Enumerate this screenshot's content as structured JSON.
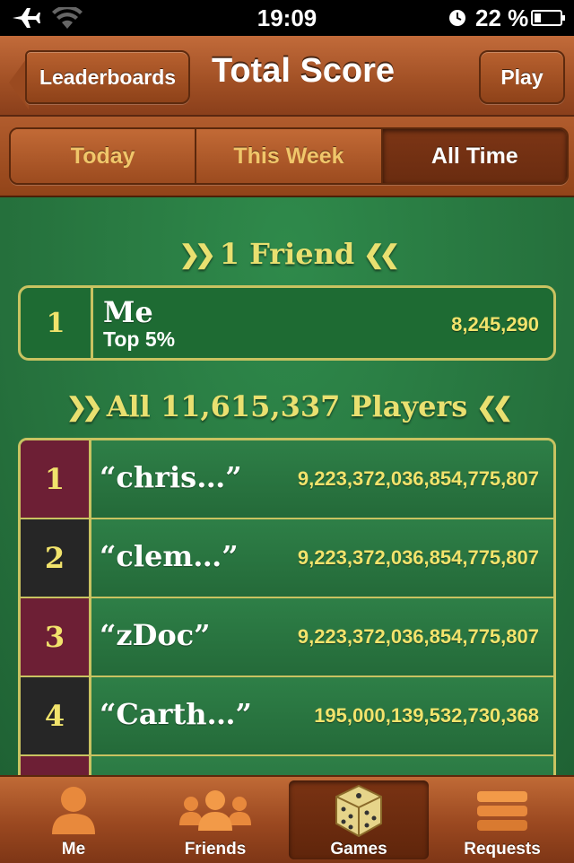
{
  "status_bar": {
    "time": "19:09",
    "battery_percent": "22 %"
  },
  "nav": {
    "back_label": "Leaderboards",
    "title": "Total Score",
    "play_label": "Play"
  },
  "segments": [
    {
      "label": "Today",
      "selected": false
    },
    {
      "label": "This Week",
      "selected": false
    },
    {
      "label": "All Time",
      "selected": true
    }
  ],
  "friends_section": {
    "header": "1 Friend",
    "me_row": {
      "rank": "1",
      "name": "Me",
      "subtitle": "Top 5%",
      "score": "8,245,290"
    }
  },
  "all_section": {
    "header": "All 11,615,337 Players",
    "rows": [
      {
        "rank": "1",
        "name": "“chris…”",
        "score": "9,223,372,036,854,775,807",
        "rank_color": "red"
      },
      {
        "rank": "2",
        "name": "“clem…”",
        "score": "9,223,372,036,854,775,807",
        "rank_color": "black"
      },
      {
        "rank": "3",
        "name": "“zDoc”",
        "score": "9,223,372,036,854,775,807",
        "rank_color": "red"
      },
      {
        "rank": "4",
        "name": "“Carth…”",
        "score": "195,000,139,532,730,368",
        "rank_color": "black"
      }
    ]
  },
  "tabs": [
    {
      "label": "Me",
      "icon": "person-icon",
      "active": false
    },
    {
      "label": "Friends",
      "icon": "friends-icon",
      "active": false
    },
    {
      "label": "Games",
      "icon": "dice-icon",
      "active": true
    },
    {
      "label": "Requests",
      "icon": "requests-icon",
      "active": false
    }
  ],
  "colors": {
    "felt": "#25703c",
    "wood": "#a04f24",
    "gold": "#f1e36c",
    "rank_red": "#6d1f35",
    "rank_black": "#262626"
  }
}
